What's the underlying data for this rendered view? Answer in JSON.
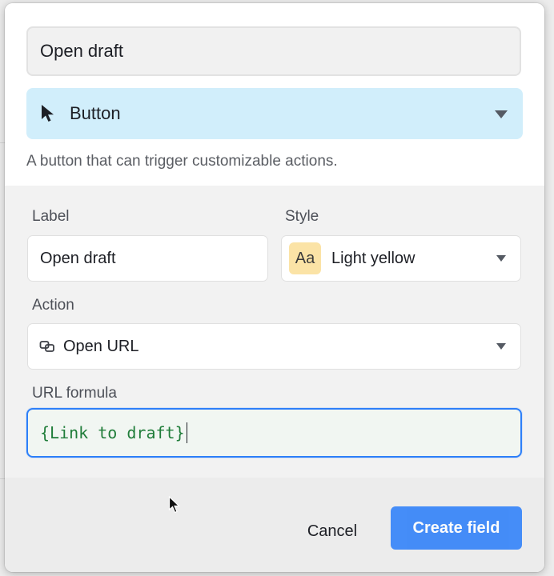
{
  "field": {
    "name_value": "Open draft"
  },
  "field_type": {
    "selected_label": "Button",
    "icon": "cursor-arrow-icon",
    "description": "A button that can trigger customizable actions."
  },
  "options": {
    "label": {
      "heading": "Label",
      "value": "Open draft"
    },
    "style": {
      "heading": "Style",
      "swatch_text": "Aa",
      "swatch_color": "#fbe3a6",
      "value": "Light yellow"
    },
    "action": {
      "heading": "Action",
      "icon": "link-icon",
      "value": "Open URL"
    },
    "url_formula": {
      "heading": "URL formula",
      "value": "{Link to draft}"
    }
  },
  "footer": {
    "cancel_label": "Cancel",
    "create_label": "Create field"
  },
  "colors": {
    "accent": "#2d7ff9",
    "type_select_bg": "#d1eefb",
    "formula_text": "#207d3a"
  }
}
